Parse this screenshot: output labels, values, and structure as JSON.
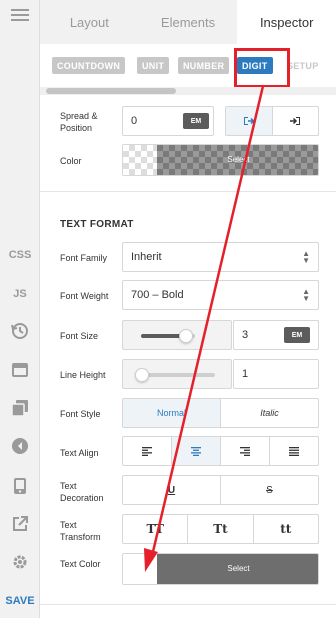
{
  "rail": {
    "css_label": "CSS",
    "js_label": "JS",
    "save_label": "SAVE"
  },
  "tabs": [
    {
      "label": "Layout"
    },
    {
      "label": "Elements"
    },
    {
      "label": "Inspector"
    }
  ],
  "subtabs": [
    {
      "label": "COUNTDOWN"
    },
    {
      "label": "UNIT"
    },
    {
      "label": "NUMBER"
    },
    {
      "label": "DIGIT"
    },
    {
      "label": "SETUP"
    }
  ],
  "spread": {
    "label": "Spread & Position",
    "value": "0",
    "unit": "EM"
  },
  "color": {
    "label": "Color",
    "select_label": "Select"
  },
  "text_format": {
    "title": "TEXT FORMAT",
    "font_family": {
      "label": "Font Family",
      "value": "Inherit"
    },
    "font_weight": {
      "label": "Font Weight",
      "value": "700 – Bold"
    },
    "font_size": {
      "label": "Font Size",
      "value": "3",
      "unit": "EM"
    },
    "line_height": {
      "label": "Line Height",
      "value": "1"
    },
    "font_style": {
      "label": "Font Style",
      "options": [
        "Normal",
        "Italic"
      ]
    },
    "text_align": {
      "label": "Text Align"
    },
    "text_decoration": {
      "label": "Text Decoration",
      "options": [
        "U",
        "S"
      ]
    },
    "text_transform": {
      "label": "Text Transform",
      "options": [
        "TT",
        "Tt",
        "tt"
      ]
    },
    "text_color": {
      "label": "Text Color",
      "select_label": "Select"
    }
  },
  "colors": {
    "accent": "#2c7bbf",
    "annotation": "#e4202a"
  }
}
